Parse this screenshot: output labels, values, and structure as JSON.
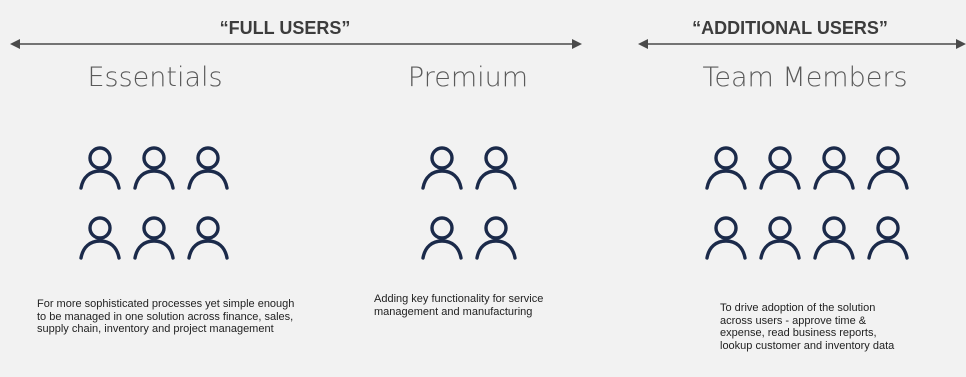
{
  "groups": {
    "full_users": {
      "heading": "“FULL USERS”"
    },
    "additional_users": {
      "heading": "“ADDITIONAL USERS”"
    }
  },
  "tiers": [
    {
      "id": "essentials",
      "title": "Essentials",
      "user_icon_count": 6,
      "description": "For more sophisticated processes yet simple enough to be managed in one solution across finance, sales, supply chain, inventory and project management"
    },
    {
      "id": "premium",
      "title": "Premium",
      "user_icon_count": 4,
      "description": "Adding key functionality for service management and manufacturing"
    },
    {
      "id": "team-members",
      "title": "Team Members",
      "user_icon_count": 8,
      "description": "To drive adoption of the solution across users - approve time & expense, read business reports, lookup customer and inventory data"
    }
  ],
  "icons": {
    "user": "person-outline-icon",
    "arrow": "double-headed-arrow"
  },
  "colors": {
    "background": "#f2f2f2",
    "icon_stroke": "#1b2a4a",
    "heading_text": "#3c3c3c",
    "title_text": "#5a5a5a",
    "arrow": "#4a4a4a"
  }
}
